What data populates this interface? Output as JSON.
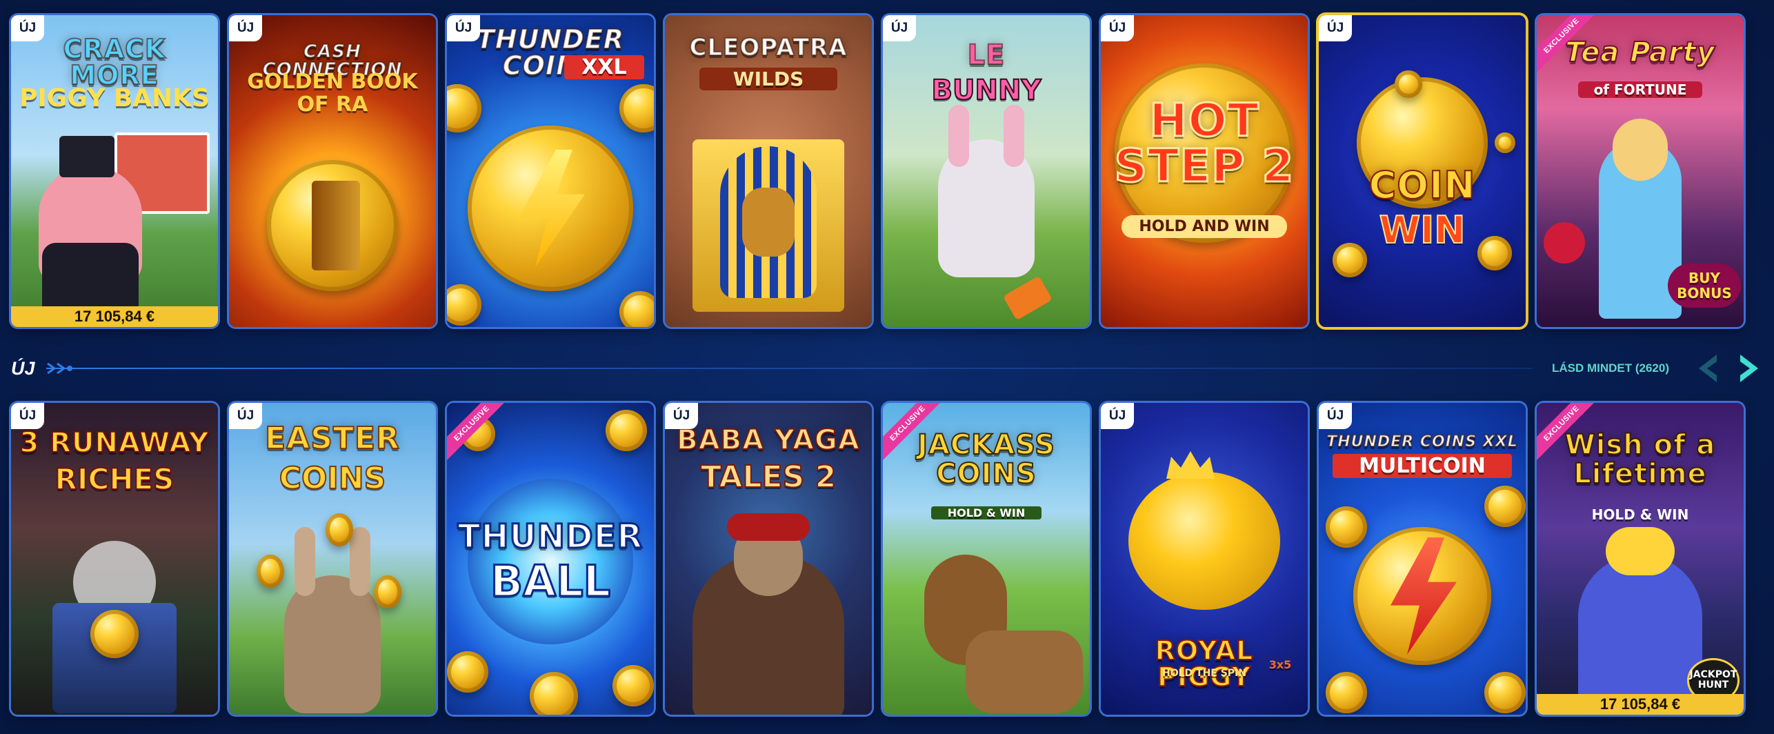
{
  "badges": {
    "new": "ÚJ",
    "exclusive": "EXCLUSIVE"
  },
  "jackpot": {
    "amount": "17 105,84 €"
  },
  "section": {
    "title": "ÚJ",
    "see_all": "LÁSD MINDET (2620)",
    "prev_icon": "chevron-left-icon",
    "next_icon": "chevron-right-icon"
  },
  "row1": [
    {
      "title": "CRACK MORE",
      "subtitle": "PIGGY BANKS",
      "new": true,
      "jackpot": true
    },
    {
      "title": "CASH CONNECTION",
      "subtitle": "GOLDEN BOOK OF RA",
      "new": true
    },
    {
      "title": "THUNDER COINS",
      "subtitle": "XXL",
      "new": true
    },
    {
      "title": "CLEOPATRA",
      "subtitle": "WILDS",
      "new": false
    },
    {
      "title": "LE",
      "subtitle": "BUNNY",
      "new": true
    },
    {
      "title": "HOT STEP 2",
      "subtitle": "HOLD AND WIN",
      "new": true
    },
    {
      "title": "COIN",
      "subtitle": "WIN",
      "new": true
    },
    {
      "title": "Tea Party",
      "subtitle": "of FORTUNE",
      "exclusive": true,
      "extra": "BUY BONUS"
    }
  ],
  "row2": [
    {
      "title": "3 RUNAWAY",
      "subtitle": "RICHES",
      "new": true
    },
    {
      "title": "EASTER",
      "subtitle": "COINS",
      "new": true
    },
    {
      "title": "THUNDER",
      "subtitle": "BALL",
      "exclusive": true
    },
    {
      "title": "BABA YAGA",
      "subtitle": "TALES 2",
      "new": true
    },
    {
      "title": "JACKASS COINS",
      "subtitle": "HOLD & WIN",
      "exclusive": true
    },
    {
      "title": "ROYAL PIGGY",
      "subtitle": "HOLD THE SPIN",
      "extra": "3x5",
      "new": true
    },
    {
      "title": "THUNDER COINS XXL",
      "subtitle": "MULTICOIN",
      "new": true
    },
    {
      "title": "Wish of a Lifetime",
      "subtitle": "HOLD & WIN",
      "exclusive": true,
      "extra": "JACKPOT HUNT",
      "jackpot": true
    }
  ],
  "colors": {
    "accent_gold": "#f5c431",
    "frame_blue": "#3b6fd4",
    "exclusive_pink": "#e8389f",
    "see_all_teal": "#5fd6c9"
  }
}
